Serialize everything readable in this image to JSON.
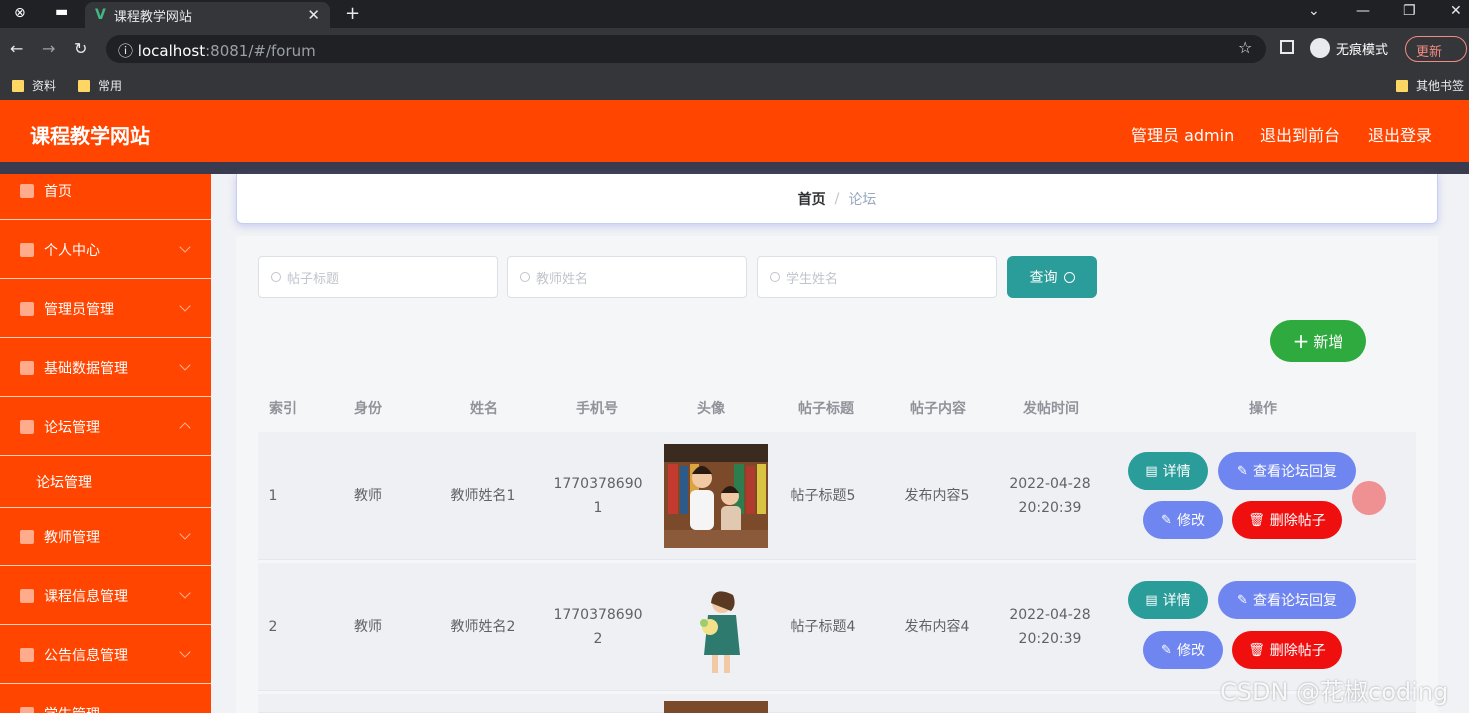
{
  "browser": {
    "tab_title": "课程教学网站",
    "tab_icon": "vue-logo-icon",
    "url_host": "localhost",
    "url_path": ":8081/#/forum",
    "incognito_label": "无痕模式",
    "update_label": "更新",
    "bookmarks": [
      "资料",
      "常用"
    ],
    "other_bookmarks": "其他书签"
  },
  "header": {
    "title": "课程教学网站",
    "admin_label": "管理员 admin",
    "front_label": "退出到前台",
    "logout_label": "退出登录",
    "accent_color": "#ff4500"
  },
  "sidebar": {
    "items": [
      {
        "label": "首页",
        "icon": "home-icon"
      },
      {
        "label": "个人中心",
        "icon": "user-icon"
      },
      {
        "label": "管理员管理",
        "icon": "admin-icon"
      },
      {
        "label": "基础数据管理",
        "icon": "info-icon"
      },
      {
        "label": "论坛管理",
        "icon": "forum-icon"
      },
      {
        "label": "教师管理",
        "icon": "chart-icon"
      },
      {
        "label": "课程信息管理",
        "icon": "course-icon"
      },
      {
        "label": "公告信息管理",
        "icon": "notice-icon"
      },
      {
        "label": "学生管理",
        "icon": "student-icon"
      }
    ],
    "submenu_label": "论坛管理"
  },
  "breadcrumb": {
    "home": "首页",
    "separator": "/",
    "current": "论坛"
  },
  "search": {
    "post_title_placeholder": "帖子标题",
    "teacher_name_placeholder": "教师姓名",
    "student_name_placeholder": "学生姓名",
    "query_label": "查询"
  },
  "add_label": "新增",
  "table": {
    "headers": [
      "索引",
      "身份",
      "姓名",
      "手机号",
      "头像",
      "帖子标题",
      "帖子内容",
      "发帖时间",
      "操作"
    ],
    "rows": [
      {
        "index": "1",
        "role": "教师",
        "name": "教师姓名1",
        "phone_a": "1770378690",
        "phone_b": "1",
        "title": "帖子标题5",
        "content": "发布内容5",
        "date": "2022-04-28",
        "time": "20:20:39"
      },
      {
        "index": "2",
        "role": "教师",
        "name": "教师姓名2",
        "phone_a": "1770378690",
        "phone_b": "2",
        "title": "帖子标题4",
        "content": "发布内容4",
        "date": "2022-04-28",
        "time": "20:20:39"
      }
    ],
    "actions": {
      "detail": "详情",
      "view_replies": "查看论坛回复",
      "edit": "修改",
      "delete": "删除帖子"
    }
  },
  "watermark": "CSDN @花椒coding"
}
